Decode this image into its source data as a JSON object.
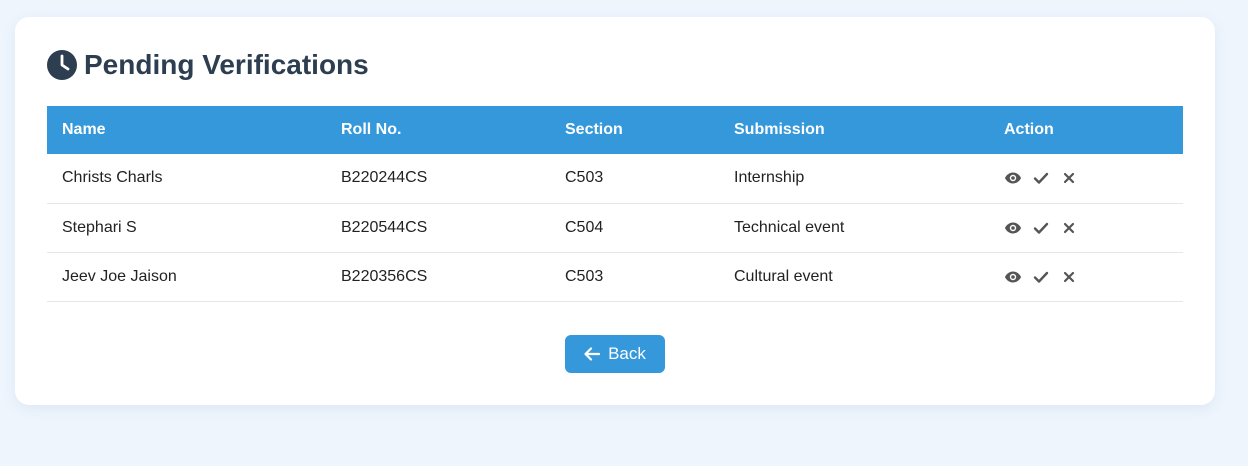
{
  "page": {
    "title": "Pending Verifications",
    "title_icon": "clock-icon"
  },
  "table": {
    "headers": [
      "Name",
      "Roll No.",
      "Section",
      "Submission",
      "Action"
    ],
    "rows": [
      {
        "name": "Christs Charls",
        "roll": "B220244CS",
        "section": "C503",
        "submission": "Internship"
      },
      {
        "name": "Stephari S",
        "roll": "B220544CS",
        "section": "C504",
        "submission": "Technical event"
      },
      {
        "name": "Jeev Joe Jaison",
        "roll": "B220356CS",
        "section": "C503",
        "submission": "Cultural event"
      }
    ],
    "action_icons": [
      "eye-icon",
      "check-icon",
      "close-icon"
    ]
  },
  "back_button": {
    "label": "Back",
    "icon": "arrow-left-icon"
  },
  "colors": {
    "accent": "#3498db",
    "title": "#2c3e50",
    "background": "#eef5fd",
    "icon": "#555555"
  }
}
